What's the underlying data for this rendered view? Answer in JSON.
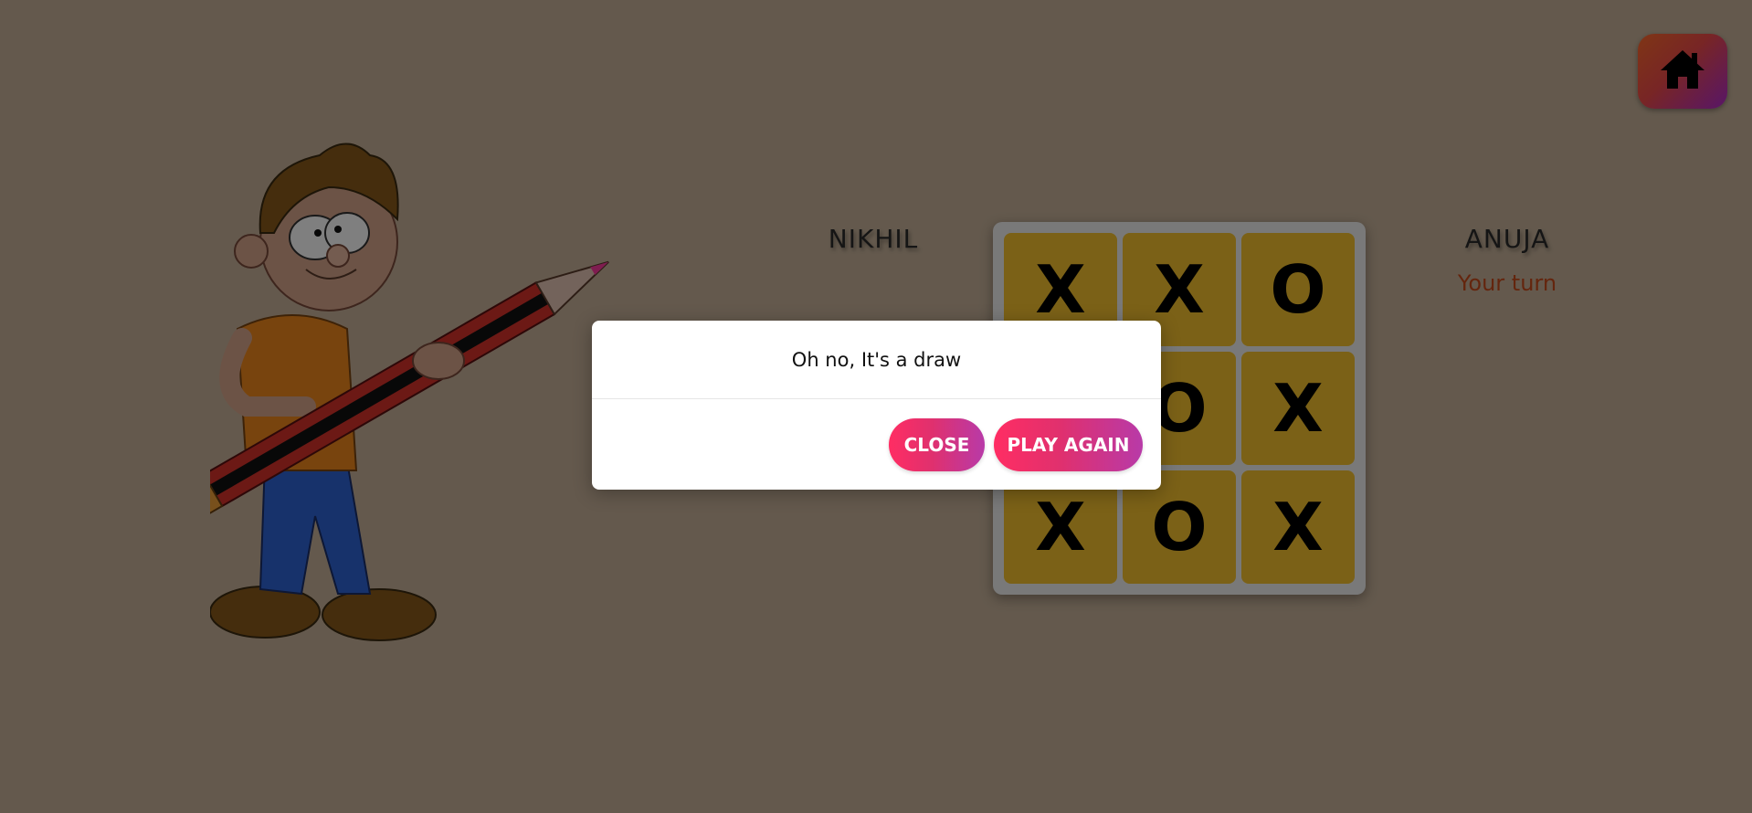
{
  "players": {
    "left": {
      "name": "NIKHIL",
      "status": ""
    },
    "right": {
      "name": "ANUJA",
      "status": "Your turn"
    }
  },
  "board": {
    "cells": [
      "X",
      "X",
      "O",
      "",
      "O",
      "X",
      "X",
      "O",
      "X"
    ]
  },
  "icons": {
    "home": "home-icon",
    "character": "boy-with-pencil-illustration"
  },
  "modal": {
    "message": "Oh no, It's a draw",
    "close_label": "CLOSE",
    "play_again_label": "PLAY AGAIN"
  },
  "colors": {
    "background": "#c8b39b",
    "cell": "#f6c22e",
    "board_frame": "#f2f2f2",
    "button_gradient_start": "#ff2d63",
    "button_gradient_end": "#b83aa8",
    "turn_text": "#c94a1b"
  }
}
